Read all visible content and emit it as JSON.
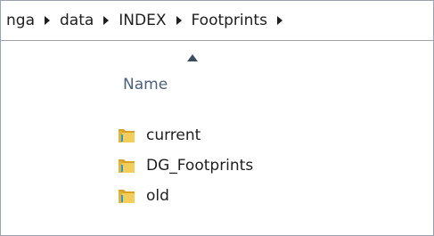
{
  "breadcrumb": {
    "items": [
      {
        "label": "nga"
      },
      {
        "label": "data"
      },
      {
        "label": "INDEX"
      },
      {
        "label": "Footprints"
      }
    ],
    "separator_icon": "chevron-right-icon"
  },
  "file_list": {
    "column_header": "Name",
    "sort_direction": "ascending",
    "items": [
      {
        "name": "current",
        "icon": "folder-icon"
      },
      {
        "name": "DG_Footprints",
        "icon": "folder-icon"
      },
      {
        "name": "old",
        "icon": "folder-icon"
      }
    ]
  },
  "colors": {
    "folder": "#e8b531",
    "header_text": "#4c607a",
    "border": "#9aa3ad"
  }
}
